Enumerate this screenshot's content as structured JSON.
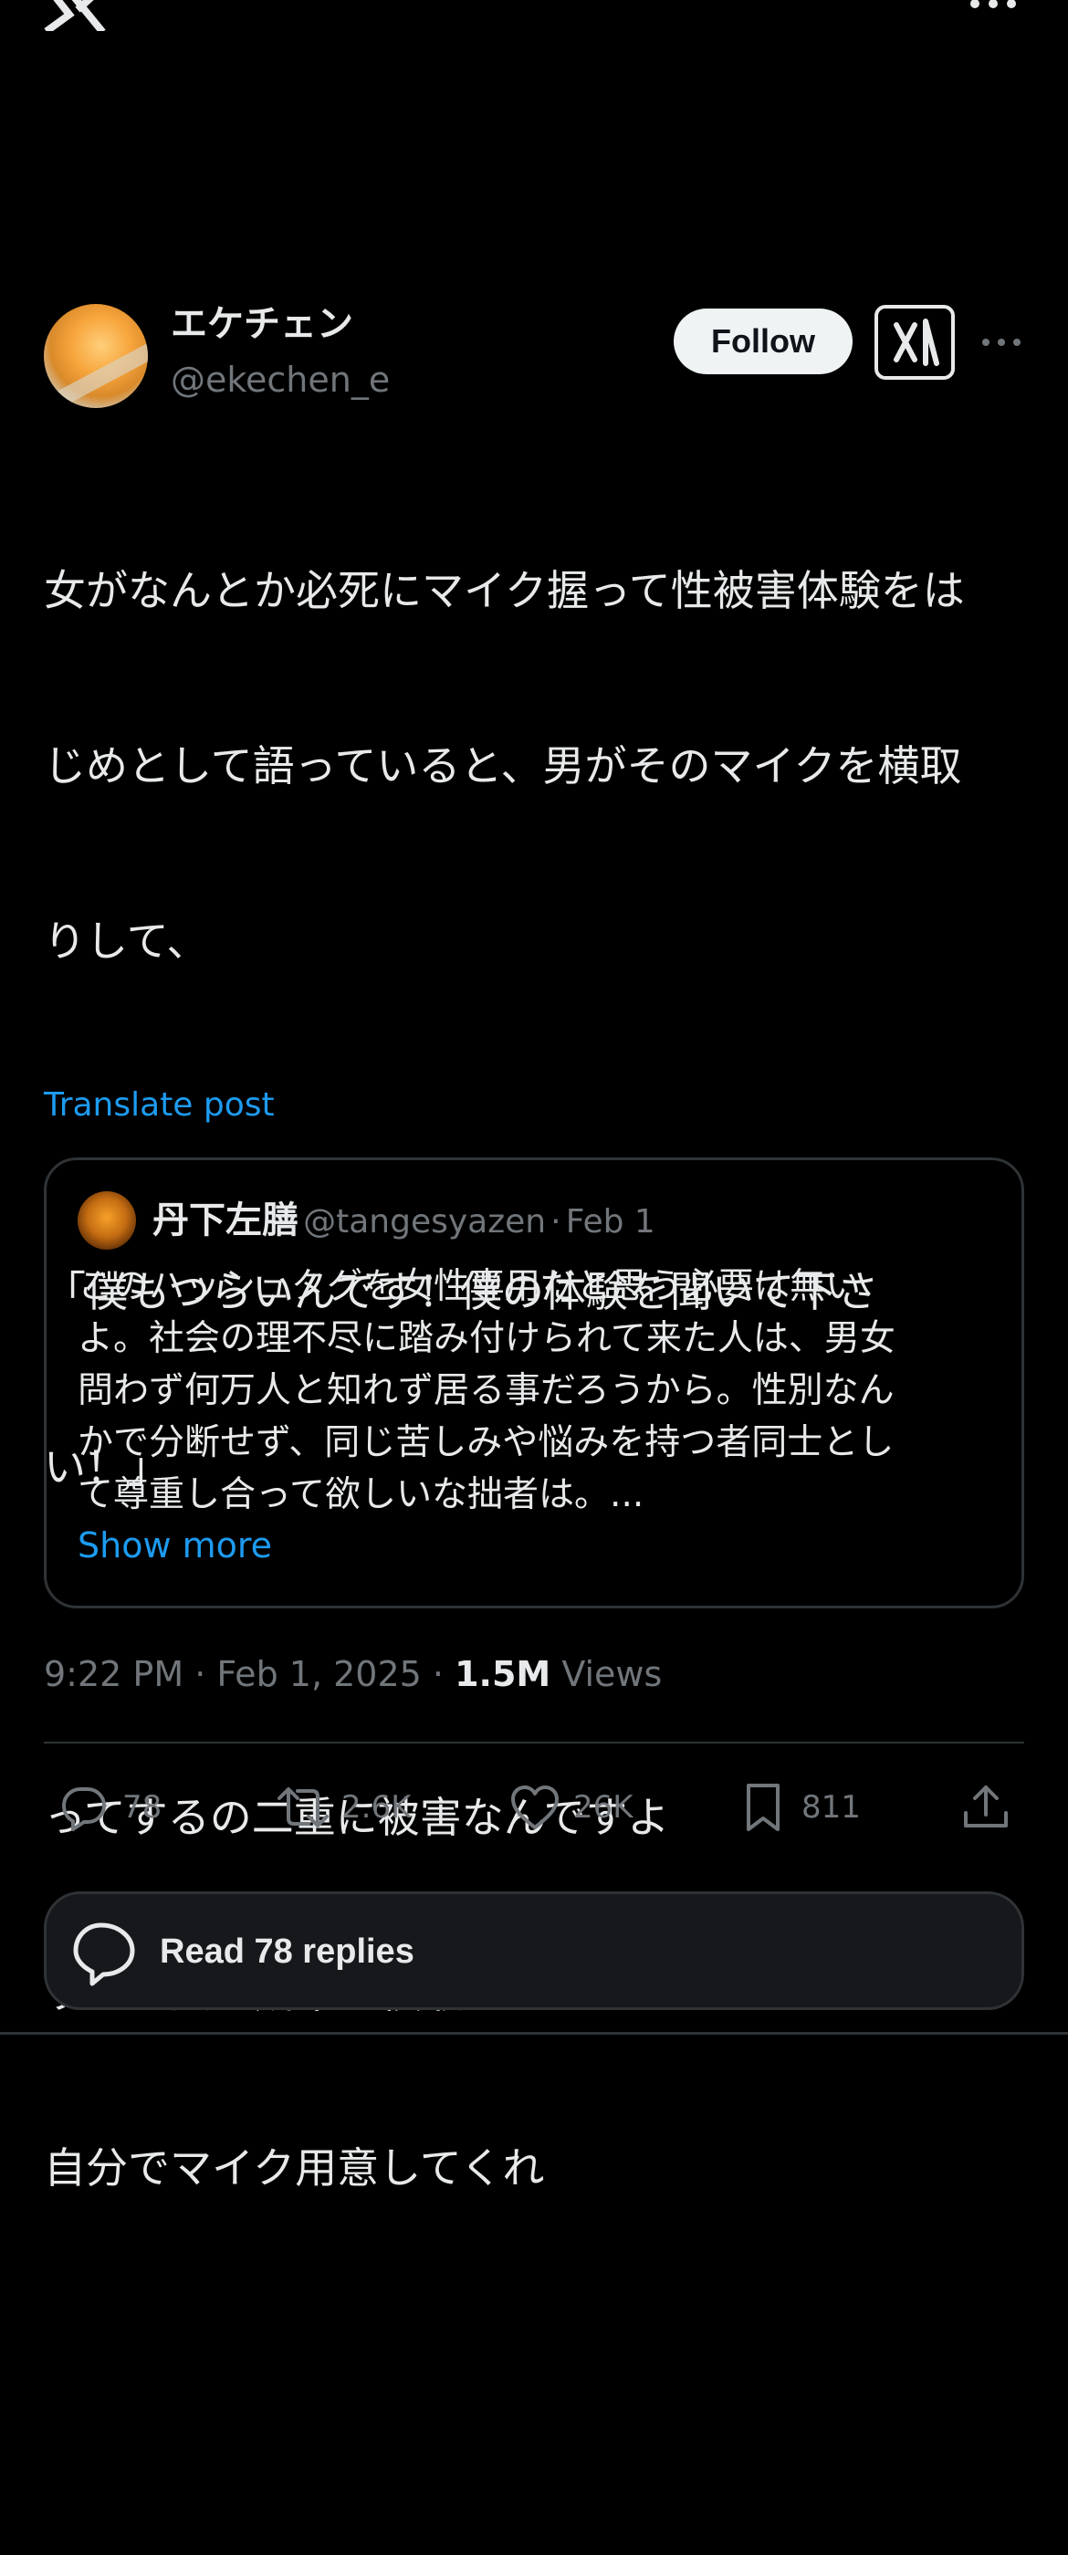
{
  "author": {
    "display_name": "エケチェン",
    "handle": "@ekechen_e",
    "follow_label": "Follow"
  },
  "post": {
    "lines": [
      "女がなんとか必死にマイク握って性被害体験をは",
      "じめとして語っていると、男がそのマイクを横取",
      "りして、",
      "",
      "「僕もつらいんです！僕の体験を聞いて下さ",
      "い！」",
      "",
      "ってするの二重に被害なんですよ",
      "すぐに人の成果を横取りするのなんなの",
      "自分でマイク用意してくれ"
    ],
    "translate_label": "Translate post"
  },
  "quote": {
    "display_name": "丹下左膳",
    "handle": "@tangesyazen",
    "separator": "·",
    "date": "Feb 1",
    "lines": [
      "このハッシュタグを女性専用だと思う必要は無い",
      "よ。社会の理不尽に踏み付けられて来た人は、男女",
      "問わず何万人と知れず居る事だろうから。性別なん",
      "かで分断せず、同じ苦しみや悩みを持つ者同士とし",
      "て尊重し合って欲しいな拙者は。..."
    ],
    "show_more_label": "Show more"
  },
  "meta": {
    "time": "9:22 PM",
    "separator": "·",
    "date": "Feb 1, 2025",
    "views_count": "1.5M",
    "views_label": "Views"
  },
  "actions": {
    "replies": "78",
    "reposts": "2.6K",
    "likes": "26K",
    "bookmarks": "811"
  },
  "read_replies_label": "Read 78 replies",
  "icons": [
    "x-logo-icon",
    "more-icon",
    "grok-icon",
    "reply-icon",
    "repost-icon",
    "like-icon",
    "bookmark-icon",
    "share-icon",
    "replies-bubble-icon"
  ],
  "colors": {
    "background": "#000000",
    "text": "#e7e9ea",
    "muted": "#71767b",
    "link": "#1d9bf0",
    "border": "#2f3336"
  }
}
